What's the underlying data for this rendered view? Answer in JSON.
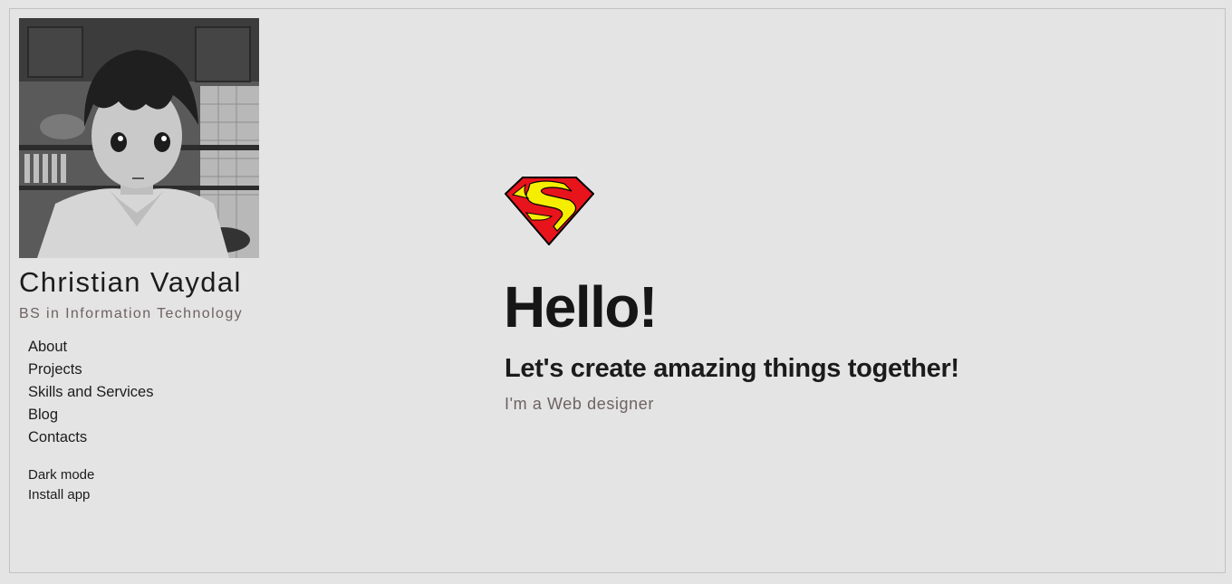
{
  "profile": {
    "name": "Christian Vaydal",
    "subtitle": "BS in Information Technology"
  },
  "nav": {
    "items": [
      "About",
      "Projects",
      "Skills and Services",
      "Blog",
      "Contacts"
    ]
  },
  "extras": {
    "dark_mode": "Dark mode",
    "install_app": "Install app"
  },
  "hero": {
    "logo_icon": "superman-logo-icon",
    "heading": "Hello!",
    "tagline": "Let's create amazing things together!",
    "role": "I'm a Web designer"
  },
  "colors": {
    "background": "#e4e4e4",
    "text": "#1a1a1a",
    "muted_text": "#6f6262",
    "logo_red": "#e8141c",
    "logo_yellow": "#f6ee00"
  }
}
